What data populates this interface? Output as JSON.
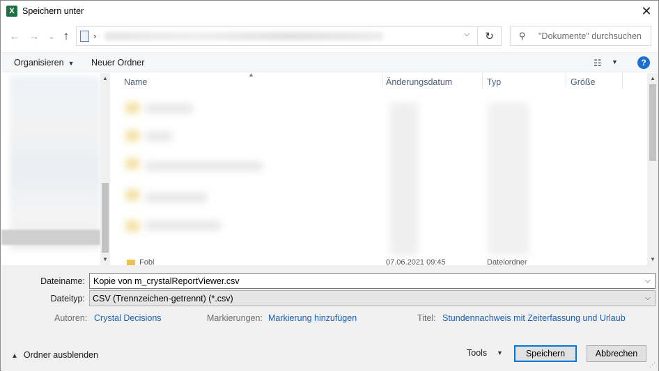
{
  "window": {
    "title": "Speichern unter",
    "app_icon_letter": "X",
    "close_label": "✕"
  },
  "nav": {
    "back_icon": "←",
    "forward_icon": "→",
    "recent_icon": "⌄",
    "up_icon": "↑",
    "address_chevron": "›",
    "refresh_icon": "↻",
    "search_placeholder": "\"Dokumente\" durchsuchen",
    "search_icon": "⚲"
  },
  "toolbar": {
    "organize_label": "Organisieren",
    "new_folder_label": "Neuer Ordner",
    "view_icon": "☷",
    "help_label": "?"
  },
  "file_list": {
    "columns": [
      "Name",
      "Änderungsdatum",
      "Typ",
      "Größe"
    ],
    "partial_row": {
      "name": "Fobi",
      "date": "07.06.2021 09:45",
      "type": "Dateiordner"
    }
  },
  "form": {
    "filename_label": "Dateiname:",
    "filename_value": "Kopie von m_crystalReportViewer.csv",
    "filetype_label": "Dateityp:",
    "filetype_value": "CSV (Trennzeichen-getrennt) (*.csv)",
    "authors_label": "Autoren:",
    "authors_value": "Crystal Decisions",
    "tags_label": "Markierungen:",
    "tags_value": "Markierung hinzufügen",
    "title_label": "Titel:",
    "title_value": "Stundennachweis mit Zeiterfassung und Urlaub"
  },
  "footer": {
    "hide_folders_label": "Ordner ausblenden",
    "tools_label": "Tools",
    "save_label": "Speichern",
    "cancel_label": "Abbrechen"
  },
  "colors": {
    "accent": "#0078d7",
    "link": "#1a5fb4",
    "excel_green": "#1e7145",
    "help_blue": "#1a6fd1"
  }
}
